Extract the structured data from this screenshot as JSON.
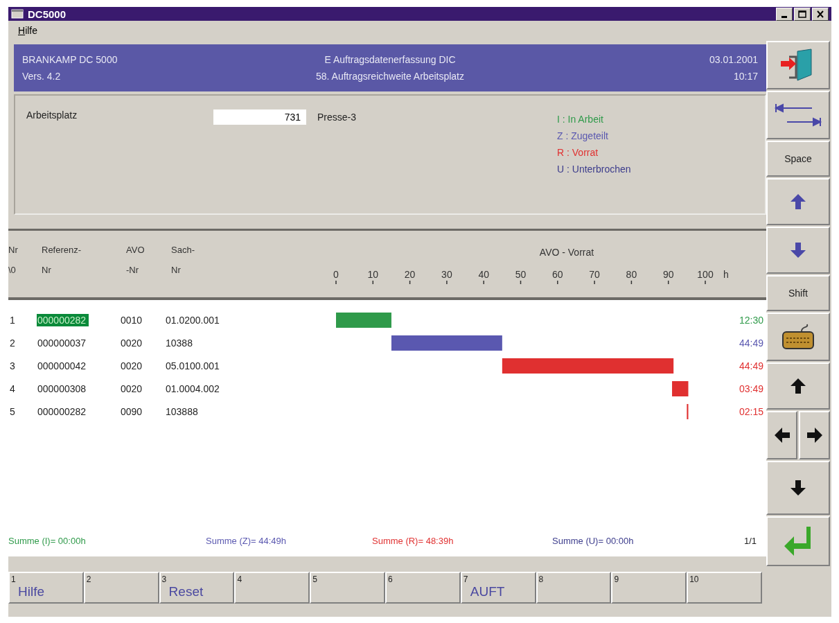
{
  "window": {
    "title": "DC5000"
  },
  "menu": [
    {
      "label": "Hilfe"
    }
  ],
  "banner": {
    "product": "BRANKAMP  DC 5000",
    "version": "Vers. 4.2",
    "module": "E Auftragsdatenerfassung DIC",
    "screen": "58. Auftragsreichweite Arbeitsplatz",
    "date": "03.01.2001",
    "time": "10:17"
  },
  "form": {
    "label": "Arbeitsplatz",
    "value": "731",
    "description": "Presse-3"
  },
  "legend": [
    {
      "text": "I : In Arbeit",
      "color": "#2f9a4a"
    },
    {
      "text": "Z : Zugeteilt",
      "color": "#5a58b0"
    },
    {
      "text": "R : Vorrat",
      "color": "#e03030"
    },
    {
      "text": "U : Unterbrochen",
      "color": "#3c3c8c"
    }
  ],
  "table": {
    "columns": [
      {
        "line1": "Nr",
        "line2": "\\0"
      },
      {
        "line1": "Referenz-",
        "line2": "Nr"
      },
      {
        "line1": "AVO",
        "line2": "-Nr"
      },
      {
        "line1": "Sach-",
        "line2": "Nr"
      }
    ],
    "rows": [
      {
        "nr": "1",
        "referenz": "000000282",
        "avo": "0010",
        "sach": "01.0200.001",
        "time": "12:30",
        "color": "#2f9a4a",
        "selected": true
      },
      {
        "nr": "2",
        "referenz": "000000037",
        "avo": "0020",
        "sach": "10388",
        "time": "44:49",
        "color": "#5a58b0",
        "selected": false
      },
      {
        "nr": "3",
        "referenz": "000000042",
        "avo": "0020",
        "sach": "05.0100.001",
        "time": "44:49",
        "color": "#e03030",
        "selected": false
      },
      {
        "nr": "4",
        "referenz": "000000308",
        "avo": "0020",
        "sach": "01.0004.002",
        "time": "03:49",
        "color": "#e03030",
        "selected": false
      },
      {
        "nr": "5",
        "referenz": "000000282",
        "avo": "0090",
        "sach": "103888",
        "time": "02:15",
        "color": "#e03030",
        "selected": false
      }
    ],
    "scale": {
      "title": "AVO - Vorrat",
      "ticks": [
        "0",
        "10",
        "20",
        "30",
        "40",
        "50",
        "60",
        "70",
        "80",
        "90",
        "100"
      ],
      "unit": "h"
    }
  },
  "sums": [
    {
      "text": "Summe (I)=  00:00h",
      "color": "#2f9a4a"
    },
    {
      "text": "Summe (Z)=  44:49h",
      "color": "#5a58b0"
    },
    {
      "text": "Summe (R)=  48:39h",
      "color": "#e03030"
    },
    {
      "text": "Summe (U)=  00:00h",
      "color": "#3c3c8c"
    }
  ],
  "page": "1/1",
  "fkeys": [
    {
      "num": "1",
      "label": "Hilfe"
    },
    {
      "num": "2"
    },
    {
      "num": "3",
      "label": "Reset"
    },
    {
      "num": "4"
    },
    {
      "num": "5"
    },
    {
      "num": "6"
    },
    {
      "num": "7",
      "label": "AUFT"
    },
    {
      "num": "8"
    },
    {
      "num": "9"
    },
    {
      "num": "10"
    }
  ],
  "side_buttons": [
    {
      "kind": "exit"
    },
    {
      "kind": "tab"
    },
    {
      "kind": "text",
      "label": "Space"
    },
    {
      "kind": "up-blue"
    },
    {
      "kind": "down-blue"
    },
    {
      "kind": "text",
      "label": "Shift"
    },
    {
      "kind": "keyboard"
    },
    {
      "kind": "up"
    },
    {
      "kind": "leftright"
    },
    {
      "kind": "down"
    },
    {
      "kind": "enter"
    }
  ]
}
